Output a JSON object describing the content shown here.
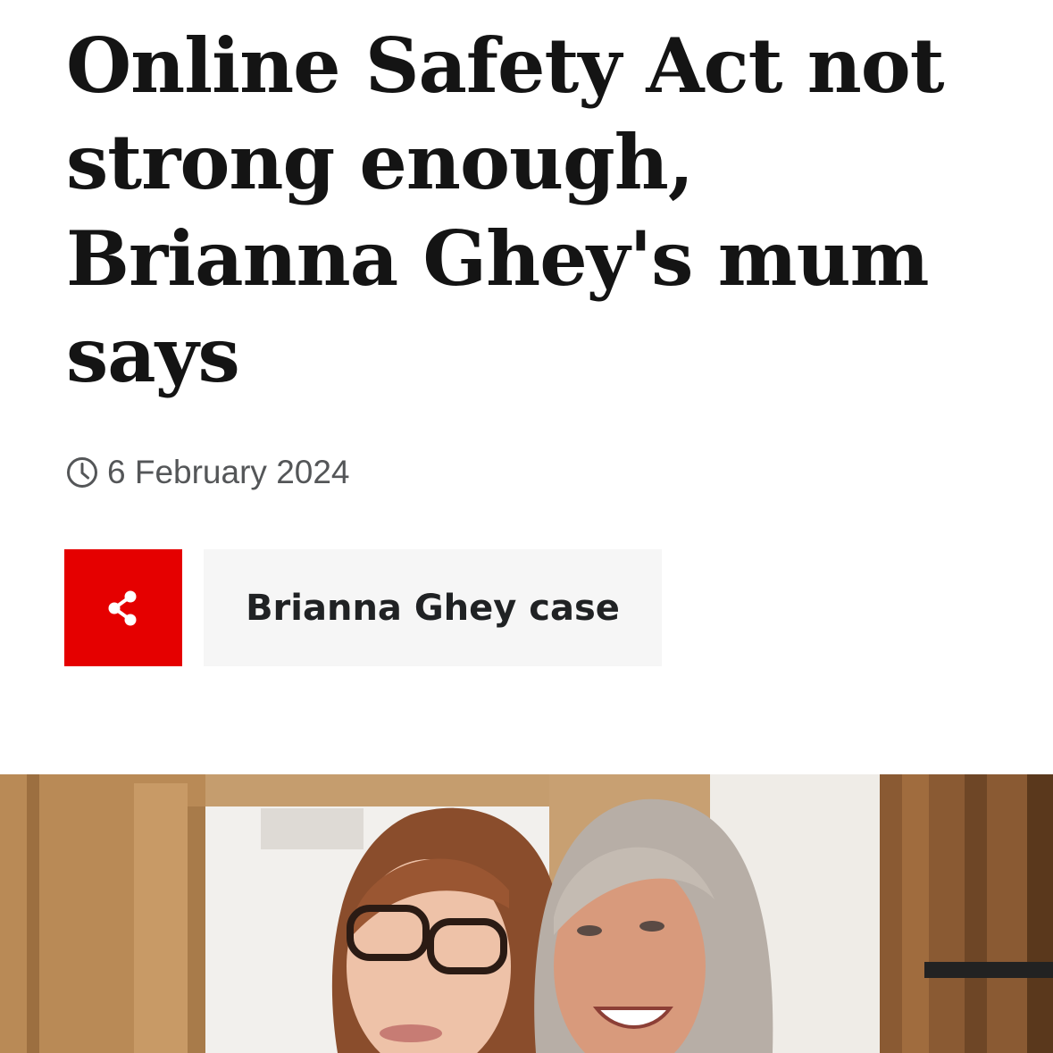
{
  "article": {
    "headline_lines": [
      "Online Safety Act not",
      "strong enough,",
      "Brianna Ghey's mum",
      "says"
    ],
    "date": "6 February 2024",
    "share": {
      "icon": "share-icon"
    },
    "topic_tag": "Brianna Ghey case",
    "accent_color": "#e50000",
    "photo": {
      "subject": "photo-two-women-smiling"
    }
  }
}
